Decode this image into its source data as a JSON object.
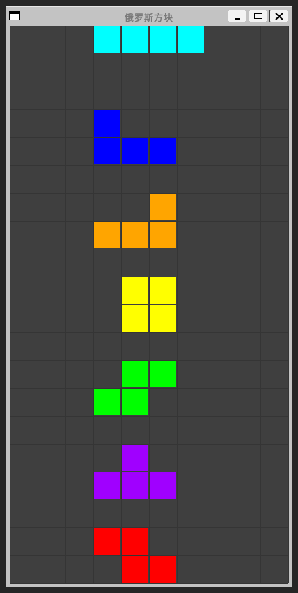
{
  "window": {
    "title": "俄罗斯方块",
    "minimize_icon": "minimize-icon",
    "maximize_icon": "maximize-icon",
    "close_icon": "close-icon"
  },
  "board": {
    "columns": 10,
    "rows": 20,
    "background": "#3f3f3f",
    "grid_color": "#353535",
    "pieces": [
      {
        "name": "I",
        "color": "#00ffff",
        "cells": [
          [
            3,
            0
          ],
          [
            4,
            0
          ],
          [
            5,
            0
          ],
          [
            6,
            0
          ]
        ]
      },
      {
        "name": "J",
        "color": "#0000ff",
        "cells": [
          [
            3,
            3
          ],
          [
            3,
            4
          ],
          [
            4,
            4
          ],
          [
            5,
            4
          ]
        ]
      },
      {
        "name": "L",
        "color": "#ffa500",
        "cells": [
          [
            5,
            6
          ],
          [
            3,
            7
          ],
          [
            4,
            7
          ],
          [
            5,
            7
          ]
        ]
      },
      {
        "name": "O",
        "color": "#ffff00",
        "cells": [
          [
            4,
            9
          ],
          [
            5,
            9
          ],
          [
            4,
            10
          ],
          [
            5,
            10
          ]
        ]
      },
      {
        "name": "S",
        "color": "#00ff00",
        "cells": [
          [
            4,
            12
          ],
          [
            5,
            12
          ],
          [
            3,
            13
          ],
          [
            4,
            13
          ]
        ]
      },
      {
        "name": "T",
        "color": "#a000ff",
        "cells": [
          [
            4,
            15
          ],
          [
            3,
            16
          ],
          [
            4,
            16
          ],
          [
            5,
            16
          ]
        ]
      },
      {
        "name": "Z",
        "color": "#ff0000",
        "cells": [
          [
            3,
            18
          ],
          [
            4,
            18
          ],
          [
            4,
            19
          ],
          [
            5,
            19
          ]
        ]
      }
    ]
  }
}
